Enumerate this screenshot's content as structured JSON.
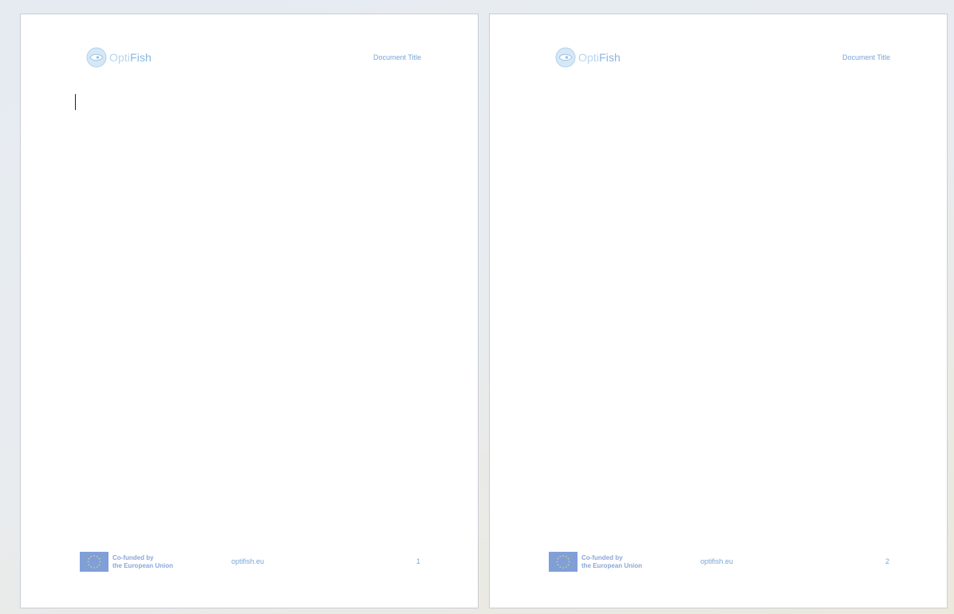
{
  "document": {
    "pages": [
      {
        "header": {
          "logo_opti": "Opti",
          "logo_fish": "Fish",
          "title": "Document Title"
        },
        "footer": {
          "eu_line1": "Co-funded by",
          "eu_line2": "the European Union",
          "url": "optifish.eu",
          "page_number": "1"
        }
      },
      {
        "header": {
          "logo_opti": "Opti",
          "logo_fish": "Fish",
          "title": "Document Title"
        },
        "footer": {
          "eu_line1": "Co-funded by",
          "eu_line2": "the European Union",
          "url": "optifish.eu",
          "page_number": "2"
        }
      }
    ]
  },
  "colors": {
    "brand_light": "#b7d5ee",
    "brand": "#88b7e0",
    "text_accent": "#7aa6d6",
    "eu_flag": "#7f9fd6"
  },
  "icons": {
    "logo": "fish-logo-icon",
    "flag": "eu-flag-icon"
  }
}
